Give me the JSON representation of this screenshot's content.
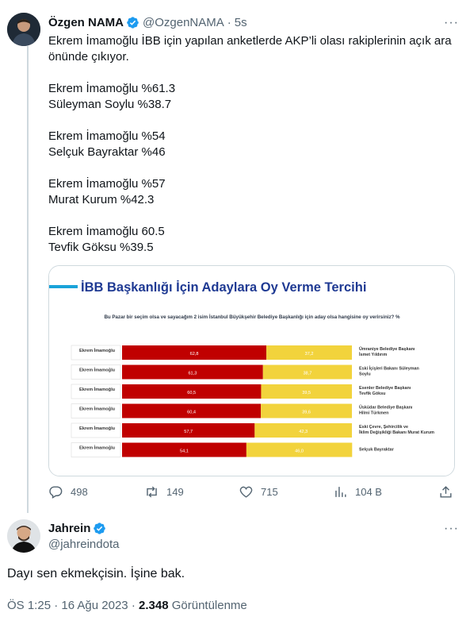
{
  "tweet": {
    "author_name": "Özgen NAMA",
    "author_handle": "@OzgenNAMA",
    "separator": "·",
    "time": "5s",
    "more": "···",
    "lines": [
      "Ekrem İmamoğlu İBB için yapılan anketlerde AKP’li olası rakiplerinin açık ara önünde çıkıyor.",
      "",
      "Ekrem İmamoğlu %61.3",
      "Süleyman Soylu %38.7",
      "",
      "Ekrem İmamoğlu %54",
      "Selçuk Bayraktar %46",
      "",
      "Ekrem İmamoğlu %57",
      "Murat Kurum %42.3",
      "",
      "Ekrem İmamoğlu 60.5",
      "Tevfik Göksu %39.5"
    ],
    "actions": {
      "replies": "498",
      "retweets": "149",
      "likes": "715",
      "views": "104 B"
    }
  },
  "poll_image": {
    "title": "İBB Başkanlığı İçin Adaylara Oy Verme Tercihi",
    "question": "Bu Pazar bir seçim olsa ve sayacağım 2 isim İstanbul Büyükşehir Belediye Başkanlığı için aday olsa hangisine oy verirsiniz? %",
    "colors": {
      "left": "#c00000",
      "right": "#f2d33c",
      "title_accent": "#1aa3d9"
    }
  },
  "chart_data": {
    "type": "bar",
    "stacked": true,
    "horizontal": true,
    "title": "İBB Başkanlığı İçin Adaylara Oy Verme Tercihi",
    "categories": [
      "Ümraniye Belediye Başkanı İsmet Yıldırım",
      "Eski İçişleri Bakanı Süleyman Soylu",
      "Esenler Belediye Başkanı Tevfik Göksu",
      "Üsküdar Belediye Başkanı Hilmi Türkmen",
      "Eski Çevre, Şehircilik ve İklim Değişikliği Bakanı Murat Kurum",
      "Selçuk Bayraktar"
    ],
    "series": [
      {
        "name": "Ekrem İmamoğlu",
        "values": [
          62.8,
          61.3,
          60.5,
          60.4,
          57.7,
          54.1
        ],
        "labels": [
          "62,8",
          "61,3",
          "60,5",
          "60,4",
          "57,7",
          "54,1"
        ]
      },
      {
        "name": "",
        "values": [
          37.2,
          38.7,
          39.5,
          39.6,
          42.3,
          46.0
        ],
        "labels": [
          "37,2",
          "38,7",
          "39,5",
          "39,6",
          "42,3",
          "46,0"
        ]
      }
    ],
    "left_labels": [
      "Ekrem İmamoğlu",
      "Ekrem İmamoğlu",
      "Ekrem İmamoğlu",
      "Ekrem İmamoğlu",
      "Ekrem İmamoğlu",
      "Ekrem İmamoğlu"
    ],
    "xlim": [
      0,
      100
    ]
  },
  "reply": {
    "author_name": "Jahrein",
    "author_handle": "@jahreindota",
    "more": "···",
    "text": "Dayı sen ekmekçisin. İşine bak.",
    "time": "ÖS 1:25",
    "separator": "·",
    "date": "16 Ağu 2023",
    "views_count": "2.348",
    "views_label": "Görüntülenme"
  },
  "colors": {
    "verified": "#1d9bf0",
    "text_secondary": "#536471",
    "border": "#cfd9de"
  }
}
